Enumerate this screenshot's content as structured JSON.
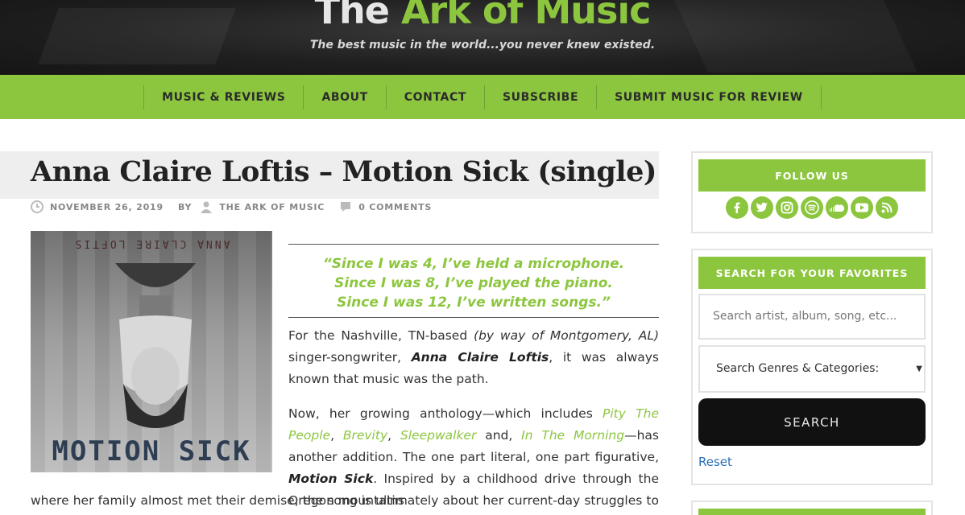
{
  "header": {
    "title_part1": "The ",
    "title_part2": "Ark of Music",
    "tagline": "The best music in the world...you never knew existed."
  },
  "nav": {
    "items": [
      "MUSIC & REVIEWS",
      "ABOUT",
      "CONTACT",
      "SUBSCRIBE",
      "SUBMIT MUSIC FOR REVIEW"
    ]
  },
  "post": {
    "title": "Anna Claire Loftis – Motion Sick (single)",
    "date": "NOVEMBER 26, 2019",
    "by_label": "BY",
    "author": "THE ARK OF MUSIC",
    "comments": "0 COMMENTS",
    "album": {
      "artist_text": "ANNA CLAIRE LOFTIS",
      "title_text": "MOTION SICK"
    },
    "quote": {
      "line1": "“Since I was 4, I’ve held a microphone.",
      "line2": "Since I was 8, I’ve played the piano.",
      "line3": "Since I was 12, I’ve written songs.”"
    },
    "para1": {
      "a": "For the Nashville, TN-based ",
      "b": "(by way of Montgomery, AL)",
      "c": " singer-songwriter, ",
      "d": "Anna Claire Loftis",
      "e": ", it was always  known that music was the path."
    },
    "para2": {
      "a": "Now, her growing anthology—which includes ",
      "link1": "Pity The People",
      "sep1": ", ",
      "link2": "Brevity",
      "sep2": ", ",
      "link3": "Sleepwalker",
      "sep3": " and, ",
      "link4": "In The Morning",
      "b": "—has another addition. The one part literal, one part figurative, ",
      "c": "Motion Sick",
      "d": ". Inspired by a childhood drive through the Oregon mountains"
    },
    "para3": "where her family almost met their demise, the song is ultimately about her current-day struggles to make it as"
  },
  "sidebar": {
    "follow_title": "FOLLOW US",
    "socials": [
      "facebook-icon",
      "twitter-icon",
      "instagram-icon",
      "spotify-icon",
      "soundcloud-icon",
      "youtube-icon",
      "rss-icon"
    ],
    "search_title": "SEARCH FOR YOUR FAVORITES",
    "search_placeholder": "Search artist, album, song, etc...",
    "genre_select": "Search Genres & Categories:",
    "search_button": "SEARCH",
    "reset": "Reset"
  },
  "colors": {
    "accent": "#8cc63e",
    "link": "#2a6fb5"
  }
}
